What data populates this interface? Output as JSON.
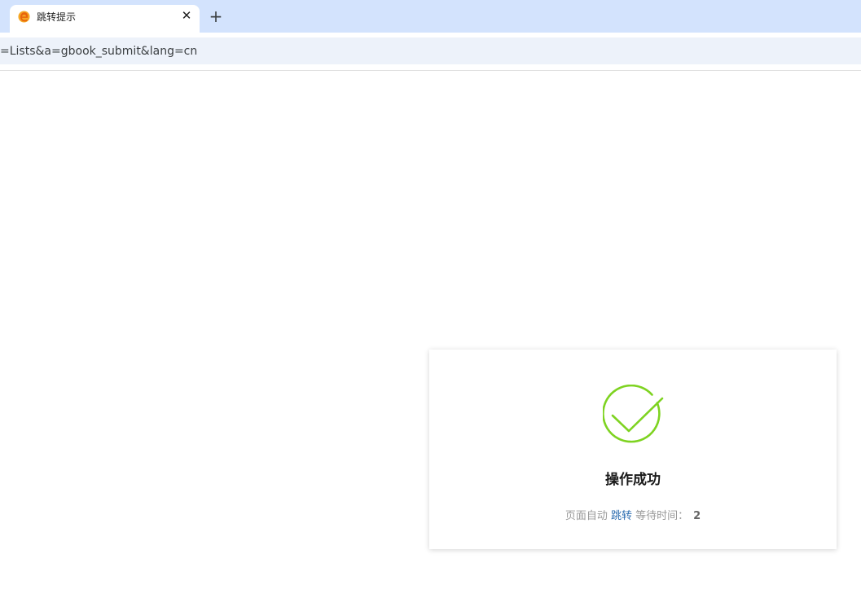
{
  "browser": {
    "tab": {
      "title": "跳转提示",
      "close_glyph": "✕",
      "favicon": "edge-e-icon"
    },
    "new_tab_glyph": "+",
    "address_bar": {
      "url": "=Lists&a=gbook_submit&lang=cn"
    }
  },
  "page": {
    "status_icon": "checkmark-circle-icon",
    "status_color": "#7ed321",
    "title": "操作成功",
    "message_prefix": "页面自动",
    "jump_link_label": "跳转",
    "wait_label": "等待时间：",
    "wait_seconds": "2"
  }
}
